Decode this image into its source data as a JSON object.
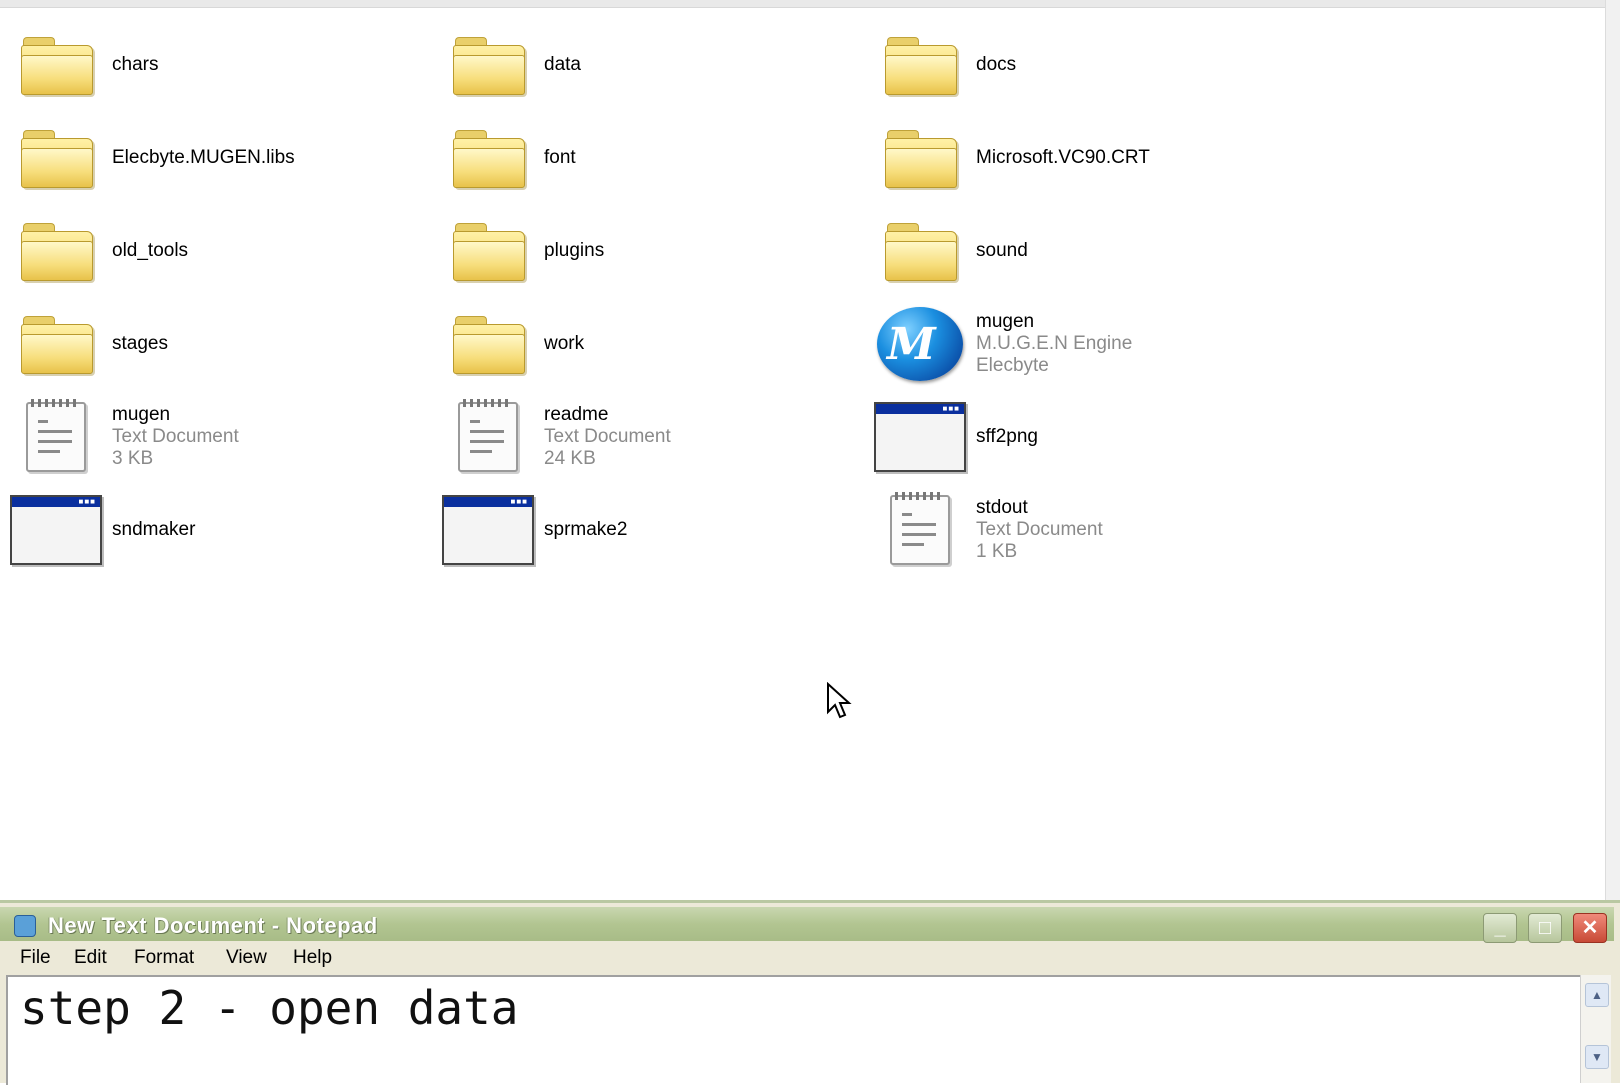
{
  "explorer": {
    "items": [
      {
        "name": "chars",
        "icon": "folder-icon"
      },
      {
        "name": "data",
        "icon": "folder-icon"
      },
      {
        "name": "docs",
        "icon": "folder-icon"
      },
      {
        "name": "Elecbyte.MUGEN.libs",
        "icon": "folder-icon"
      },
      {
        "name": "font",
        "icon": "folder-icon"
      },
      {
        "name": "Microsoft.VC90.CRT",
        "icon": "folder-icon"
      },
      {
        "name": "old_tools",
        "icon": "folder-icon"
      },
      {
        "name": "plugins",
        "icon": "folder-icon"
      },
      {
        "name": "sound",
        "icon": "folder-icon"
      },
      {
        "name": "stages",
        "icon": "folder-icon"
      },
      {
        "name": "work",
        "icon": "folder-icon"
      },
      {
        "name": "mugen",
        "line2": "M.U.G.E.N Engine",
        "line3": "Elecbyte",
        "icon": "mugen-logo-icon"
      },
      {
        "name": "mugen",
        "line2": "Text Document",
        "line3": "3 KB",
        "icon": "text-document-icon"
      },
      {
        "name": "readme",
        "line2": "Text Document",
        "line3": "24 KB",
        "icon": "text-document-icon"
      },
      {
        "name": "sff2png",
        "icon": "application-window-icon"
      },
      {
        "name": "sndmaker",
        "icon": "application-window-icon"
      },
      {
        "name": "sprmake2",
        "icon": "application-window-icon"
      },
      {
        "name": "stdout",
        "line2": "Text Document",
        "line3": "1 KB",
        "icon": "text-document-icon"
      }
    ]
  },
  "notepad": {
    "title": "New Text Document - Notepad",
    "menu": [
      "File",
      "Edit",
      "Format",
      "View",
      "Help"
    ],
    "content": "step 2 - open data",
    "buttons": {
      "minimize": "_",
      "maximize": "□",
      "close": "✕"
    }
  },
  "colors": {
    "titlebar": "#b2c591",
    "folder": "#f6dc78",
    "exe_titlebar": "#0a2f9e"
  }
}
